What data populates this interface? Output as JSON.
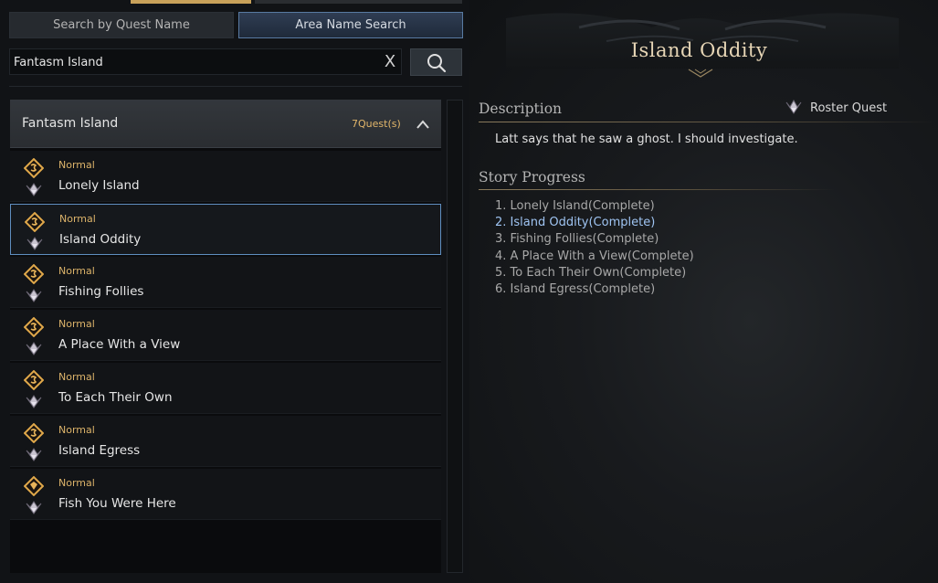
{
  "tabs": {
    "quest_name": "Search by Quest Name",
    "area_name": "Area Name Search"
  },
  "search": {
    "value": "Fantasm Island",
    "clear_label": "X"
  },
  "area": {
    "name": "Fantasm Island",
    "count": "7Quest(s)"
  },
  "quests": [
    {
      "type": "Normal",
      "name": "Lonely Island",
      "icon": "quest-scroll-icon"
    },
    {
      "type": "Normal",
      "name": "Island Oddity",
      "icon": "quest-scroll-icon"
    },
    {
      "type": "Normal",
      "name": "Fishing Follies",
      "icon": "quest-scroll-icon"
    },
    {
      "type": "Normal",
      "name": "A Place With a View",
      "icon": "quest-scroll-icon"
    },
    {
      "type": "Normal",
      "name": "To Each Their Own",
      "icon": "quest-scroll-icon"
    },
    {
      "type": "Normal",
      "name": "Island Egress",
      "icon": "quest-scroll-icon"
    },
    {
      "type": "Normal",
      "name": "Fish You Were Here",
      "icon": "quest-diamond-icon"
    }
  ],
  "detail": {
    "title": "Island Oddity",
    "description_label": "Description",
    "roster_label": "Roster Quest",
    "description": "Latt says that he saw a ghost. I should investigate.",
    "progress_label": "Story Progress",
    "progress": [
      "1. Lonely Island(Complete)",
      "2. Island Oddity(Complete)",
      "3. Fishing Follies(Complete)",
      "4. A Place With a View(Complete)",
      "5. To Each Their Own(Complete)",
      "6. Island Egress(Complete)"
    ]
  },
  "colors": {
    "accent_gold": "#dcb36a",
    "selection_border": "#5f8ec0",
    "current_progress": "#9fc4f2"
  }
}
